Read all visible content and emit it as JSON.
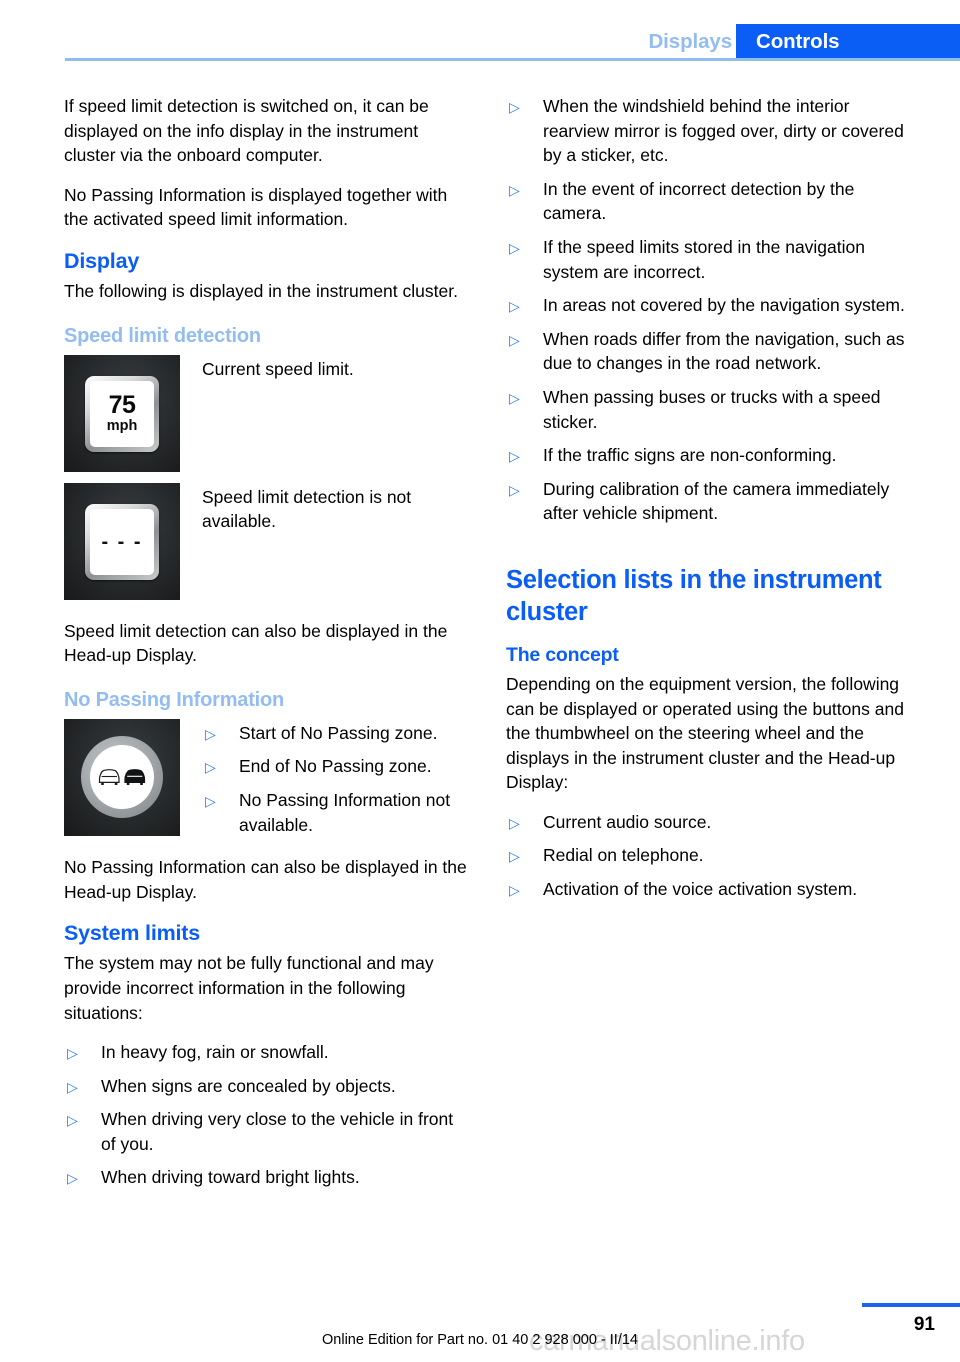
{
  "header": {
    "tab_inactive": "Displays",
    "tab_active": "Controls"
  },
  "left_column": {
    "intro_paragraph_1": "If speed limit detection is switched on, it can be displayed on the info display in the instrument cluster via the onboard computer.",
    "intro_paragraph_2": "No Passing Information is displayed together with the activated speed limit information.",
    "display_heading": "Display",
    "display_paragraph": "The following is displayed in the instrument cluster.",
    "speed_limit_heading": "Speed limit detection",
    "figures": [
      {
        "icon": "speed-limit-sign-75-mph",
        "sign_value": "75",
        "sign_unit": "mph",
        "caption": "Current speed limit."
      },
      {
        "icon": "speed-limit-sign-unavailable",
        "sign_value": "- - -",
        "caption": "Speed limit detection is not available."
      }
    ],
    "headup_paragraph": "Speed limit detection can also be displayed in the Head-up Display.",
    "no_passing_heading": "No Passing Information",
    "no_passing_icon": "no-passing-zone-sign",
    "no_passing_items": [
      "Start of No Passing zone.",
      "End of No Passing zone.",
      "No Passing Information not available."
    ],
    "no_passing_paragraph": "No Passing Information can also be displayed in the Head-up Display.",
    "system_limits_heading": "System limits",
    "system_limits_paragraph": "The system may not be fully functional and may provide incorrect information in the following situations:",
    "system_limits_items": [
      "In heavy fog, rain or snowfall.",
      "When signs are concealed by objects.",
      "When driving very close to the vehicle in front of you.",
      "When driving toward bright lights."
    ]
  },
  "right_column": {
    "continued_items": [
      "When the windshield behind the interior rearview mirror is fogged over, dirty or covered by a sticker, etc.",
      "In the event of incorrect detection by the camera.",
      "If the speed limits stored in the navigation system are incorrect.",
      "In areas not covered by the navigation system.",
      "When roads differ from the navigation, such as due to changes in the road network.",
      "When passing buses or trucks with a speed sticker.",
      "If the traffic signs are non-conforming.",
      "During calibration of the camera immediately after vehicle shipment."
    ],
    "section_title": "Selection lists in the instrument cluster",
    "concept_heading": "The concept",
    "concept_paragraph": "Depending on the equipment version, the following can be displayed or operated using the buttons and the thumbwheel on the steering wheel and the displays in the instrument cluster and the Head-up Display:",
    "concept_items": [
      "Current audio source.",
      "Redial on telephone.",
      "Activation of the voice activation system."
    ]
  },
  "footer": {
    "page_number": "91",
    "edition_line": "Online Edition for Part no. 01 40 2 928 000 - II/14",
    "watermark": "carmanualsonline.info"
  },
  "bullet_glyph": "▷",
  "colors": {
    "accent_blue": "#0a5ef5",
    "light_blue": "#93bdf2",
    "bullet_blue": "#2a7bf0"
  }
}
